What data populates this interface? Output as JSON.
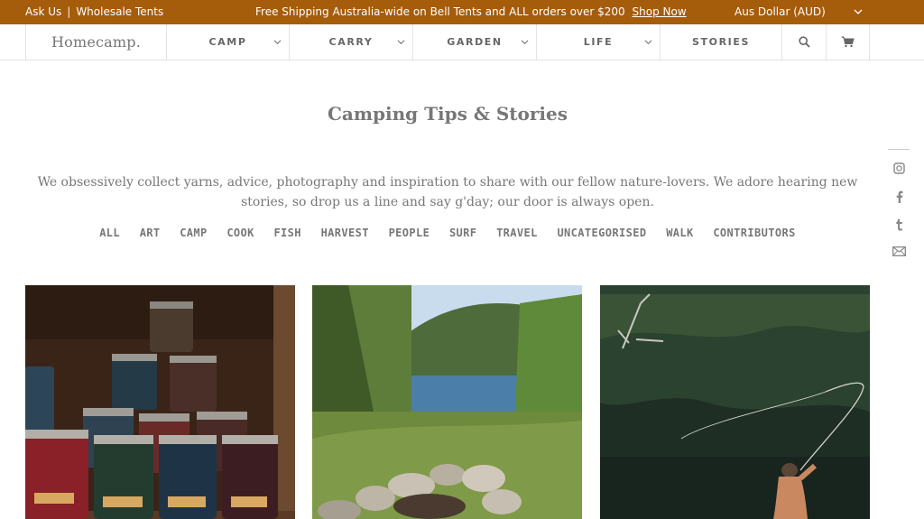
{
  "topbar": {
    "ask_us": "Ask Us",
    "separator": "|",
    "wholesale": "Wholesale Tents",
    "promo": "Free Shipping Australia-wide on Bell Tents and ALL orders over $200",
    "shop_now": "Shop Now",
    "currency": "Aus Dollar (AUD)",
    "bg_color": "#a55c0b"
  },
  "nav": {
    "logo": "Homecamp.",
    "items": [
      {
        "label": "CAMP"
      },
      {
        "label": "CARRY"
      },
      {
        "label": "GARDEN"
      },
      {
        "label": "LIFE"
      },
      {
        "label": "STORIES"
      }
    ],
    "search_icon": "search-icon",
    "cart_icon": "cart-icon"
  },
  "main": {
    "title": "Camping Tips & Stories",
    "intro": "We obsessively collect yarns, advice, photography and inspiration to share with our fellow nature-lovers. We adore hearing new stories, so drop us a line and say g'day; our door is always open.",
    "categories": [
      "ALL",
      "ART",
      "CAMP",
      "COOK",
      "FISH",
      "HARVEST",
      "PEOPLE",
      "SURF",
      "TRAVEL",
      "UNCATEGORISED",
      "WALK",
      "CONTRIBUTORS"
    ]
  },
  "social": [
    "instagram-icon",
    "facebook-icon",
    "tumblr-icon",
    "email-icon"
  ],
  "cards": [
    {
      "image": "candle-tins-photo"
    },
    {
      "image": "campfire-lake-photo"
    },
    {
      "image": "fly-fishing-photo"
    }
  ]
}
